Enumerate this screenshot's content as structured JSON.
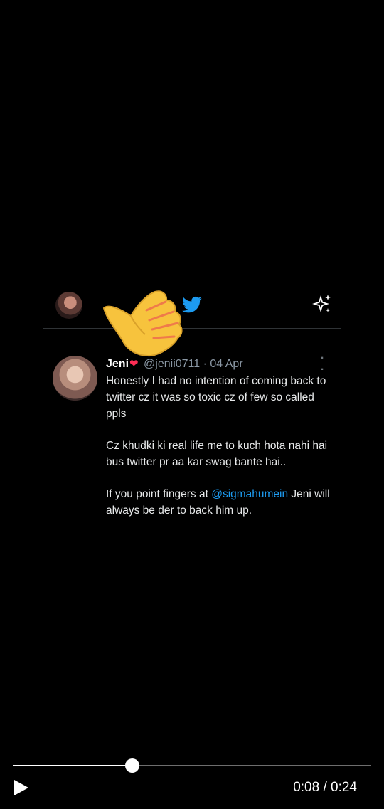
{
  "tweet": {
    "name": "Jeni",
    "name_emoji": "❤",
    "handle": "@jenii0711",
    "separator": "·",
    "date": "04 Apr",
    "paragraph_1": "Honestly I had no intention of coming back to twitter cz it was so toxic cz of few so called ppls",
    "paragraph_2": "Cz khudki ki real life me to kuch hota nahi hai bus twitter pr aa kar swag bante hai..",
    "paragraph_3_before": "If you point fingers at ",
    "paragraph_3_mention": "@sigmahumein",
    "paragraph_3_after": " Jeni will always be der to back him up."
  },
  "header": {
    "icons": [
      "profile-avatar",
      "twitter-bird-icon",
      "sparkle-icon"
    ]
  },
  "overlay": {
    "icon": "thumbs-up-hand-emoji"
  },
  "player": {
    "current_time": "0:08",
    "time_separator": " / ",
    "duration": "0:24",
    "progress": 0.3333,
    "play_icon": "play-icon"
  },
  "colors": {
    "background": "#000000",
    "twitter_blue": "#1d9bf0",
    "heart": "#ff2d55",
    "muted": "#8b98a5"
  }
}
